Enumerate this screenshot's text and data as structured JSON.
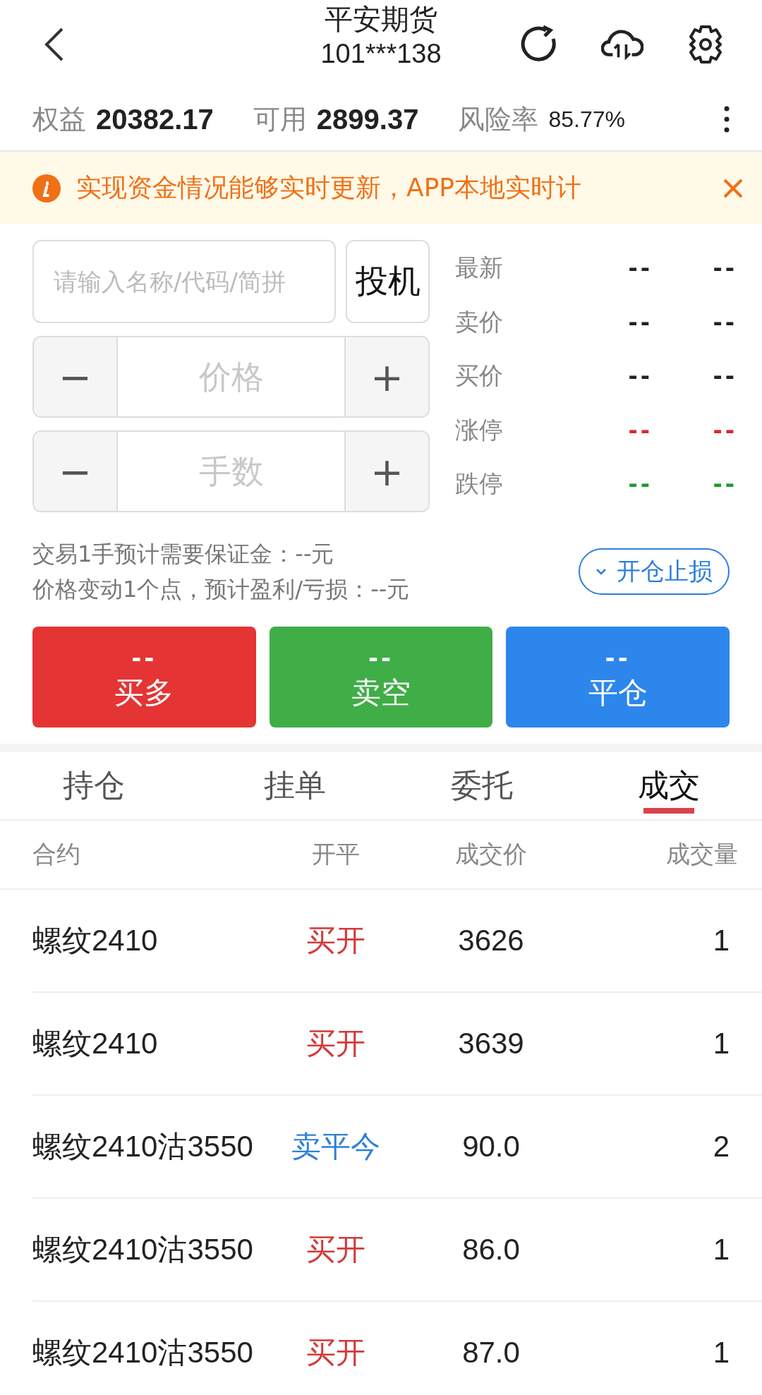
{
  "header": {
    "title": "平安期货",
    "account": "101***138"
  },
  "summary": [
    {
      "label": "权益",
      "value": "20382.17",
      "kind": "large"
    },
    {
      "label": "可用",
      "value": "2899.37",
      "kind": "large"
    },
    {
      "label": "风险率",
      "value": "85.77%",
      "kind": "small"
    }
  ],
  "notice": {
    "text": "实现资金情况能够实时更新，APP本地实时计"
  },
  "order_form": {
    "search": {
      "placeholder": "请输入名称/代码/简拼"
    },
    "hedge_button": "投机",
    "steppers": [
      {
        "minus": "−",
        "placeholder": "价格",
        "plus": "+"
      },
      {
        "minus": "−",
        "placeholder": "手数",
        "plus": "+"
      }
    ],
    "margin_note": "交易1手预计需要保证金：--元",
    "pnl_note": "价格变动1个点，预计盈利/亏损：--元",
    "stop_loss_button": "开仓止损"
  },
  "quotes": [
    {
      "label": "最新",
      "value_1": "--",
      "value_2": "--",
      "kind": "neutral"
    },
    {
      "label": "卖价",
      "value_1": "--",
      "value_2": "--",
      "kind": "neutral"
    },
    {
      "label": "买价",
      "value_1": "--",
      "value_2": "--",
      "kind": "neutral"
    },
    {
      "label": "涨停",
      "value_1": "--",
      "value_2": "--",
      "kind": "up"
    },
    {
      "label": "跌停",
      "value_1": "--",
      "value_2": "--",
      "kind": "down"
    }
  ],
  "actions": [
    {
      "price": "--",
      "label": "买多",
      "kind": "buy"
    },
    {
      "price": "--",
      "label": "卖空",
      "kind": "sell"
    },
    {
      "price": "--",
      "label": "平仓",
      "kind": "close"
    }
  ],
  "tabs": [
    {
      "label": "持仓",
      "selected": false
    },
    {
      "label": "挂单",
      "selected": false
    },
    {
      "label": "委托",
      "selected": false
    },
    {
      "label": "成交",
      "selected": true
    }
  ],
  "table": {
    "columns": [
      "合约",
      "开平",
      "成交价",
      "成交量"
    ],
    "rows": [
      {
        "contract": "螺纹2410",
        "open_close": "买开",
        "kind": "buy",
        "price": "3626",
        "volume": "1"
      },
      {
        "contract": "螺纹2410",
        "open_close": "买开",
        "kind": "buy",
        "price": "3639",
        "volume": "1"
      },
      {
        "contract": "螺纹2410沽3550",
        "open_close": "卖平今",
        "kind": "sell",
        "price": "90.0",
        "volume": "2"
      },
      {
        "contract": "螺纹2410沽3550",
        "open_close": "买开",
        "kind": "buy",
        "price": "86.0",
        "volume": "1"
      },
      {
        "contract": "螺纹2410沽3550",
        "open_close": "买开",
        "kind": "buy",
        "price": "87.0",
        "volume": "1"
      }
    ]
  }
}
